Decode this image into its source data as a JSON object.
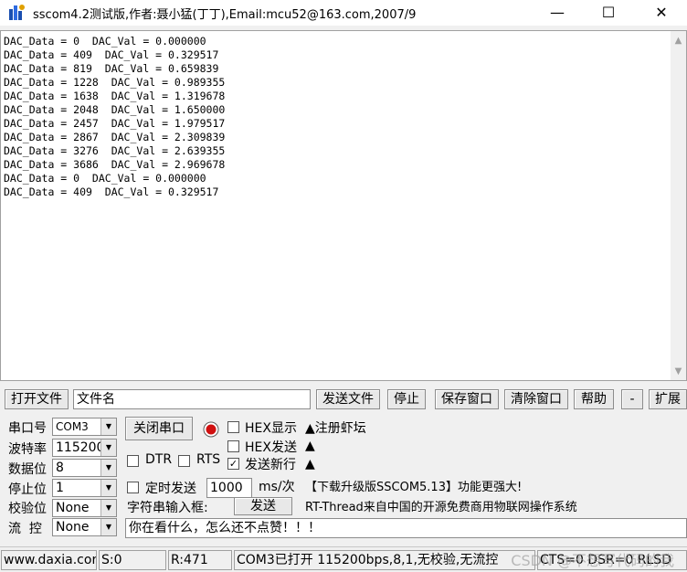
{
  "window": {
    "title": "sscom4.2测试版,作者:聂小猛(丁丁),Email:mcu52@163.com,2007/9",
    "minimize": "—",
    "maximize": "☐",
    "close": "✕",
    "icon": "chip-app-icon"
  },
  "output": {
    "lines": [
      "DAC_Data = 0  DAC_Val = 0.000000",
      "DAC_Data = 409  DAC_Val = 0.329517",
      "DAC_Data = 819  DAC_Val = 0.659839",
      "DAC_Data = 1228  DAC_Val = 0.989355",
      "DAC_Data = 1638  DAC_Val = 1.319678",
      "DAC_Data = 2048  DAC_Val = 1.650000",
      "DAC_Data = 2457  DAC_Val = 1.979517",
      "DAC_Data = 2867  DAC_Val = 2.309839",
      "DAC_Data = 3276  DAC_Val = 2.639355",
      "DAC_Data = 3686  DAC_Val = 2.969678",
      "DAC_Data = 0  DAC_Val = 0.000000",
      "DAC_Data = 409  DAC_Val = 0.329517"
    ]
  },
  "toolbar": {
    "open_file": "打开文件",
    "filename": "文件名",
    "send_file": "发送文件",
    "stop": "停止",
    "save_window": "保存窗口",
    "clear_window": "清除窗口",
    "help": "帮助",
    "minus": "-",
    "expand": "扩展"
  },
  "settings": {
    "port_label": "串口号",
    "port_value": "COM3",
    "baud_label": "波特率",
    "baud_value": "115200",
    "databits_label": "数据位",
    "databits_value": "8",
    "stopbits_label": "停止位",
    "stopbits_value": "1",
    "parity_label": "校验位",
    "parity_value": "None",
    "flow_label": "流  控",
    "flow_value": "None"
  },
  "controls": {
    "close_port": "关闭串口",
    "hex_display": "HEX显示",
    "hex_send": "HEX发送",
    "dtr": "DTR",
    "rts": "RTS",
    "send_newline": "发送新行",
    "timed_send": "定时发送",
    "interval_value": "1000",
    "interval_unit": "ms/次",
    "input_label": "字符串输入框:",
    "send": "发送",
    "input_text": "你在看什么，怎么还不点赞！！！",
    "send_newline_checked": true
  },
  "info": {
    "line1": "▲注册虾坛",
    "line2": "▲",
    "line3": "▲",
    "line4": "【下载升级版SSCOM5.13】功能更强大!",
    "line5": "RT-Thread来自中国的开源免费商用物联网操作系统"
  },
  "status": {
    "site": "www.daxia.cor",
    "sent": "S:0",
    "received": "R:471",
    "port_status": "COM3已打开  115200bps,8,1,无校验,无流控",
    "lines": "CTS=0 DSR=0 RLSD"
  },
  "watermark": "CSDN @不想写代码的我",
  "colors": {
    "indicator": "#d01010"
  }
}
